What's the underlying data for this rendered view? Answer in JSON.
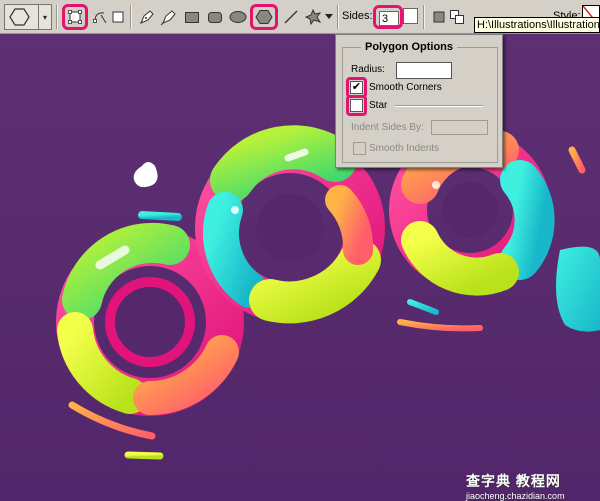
{
  "toolbar": {
    "preset_arrow": "▾",
    "sides_label": "Sides:",
    "sides_value": "3",
    "style_label": "Style:",
    "tooltip": "H:\\Illustrations\\Illustration",
    "highlight_color": "#e3136e",
    "tools": [
      "path-mode-icon",
      "paths-icon",
      "fill-pixels-icon",
      "pen-icon",
      "freeform-pen-icon",
      "rectangle-icon",
      "rounded-rectangle-icon",
      "ellipse-icon",
      "polygon-icon",
      "line-icon",
      "custom-shape-icon"
    ]
  },
  "polygon_options": {
    "title": "Polygon Options",
    "radius_label": "Radius:",
    "radius_value": "",
    "smooth_corners_label": "Smooth Corners",
    "smooth_corners_checked": true,
    "star_label": "Star",
    "star_checked": false,
    "indent_label": "Indent Sides By:",
    "indent_value": "",
    "smooth_indents_label": "Smooth Indents",
    "smooth_indents_checked": false
  },
  "canvas": {
    "background": "#5a2d6e"
  },
  "watermark": {
    "top": "查字典 教程网",
    "bottom": "jiaocheng.chazidian.com"
  }
}
